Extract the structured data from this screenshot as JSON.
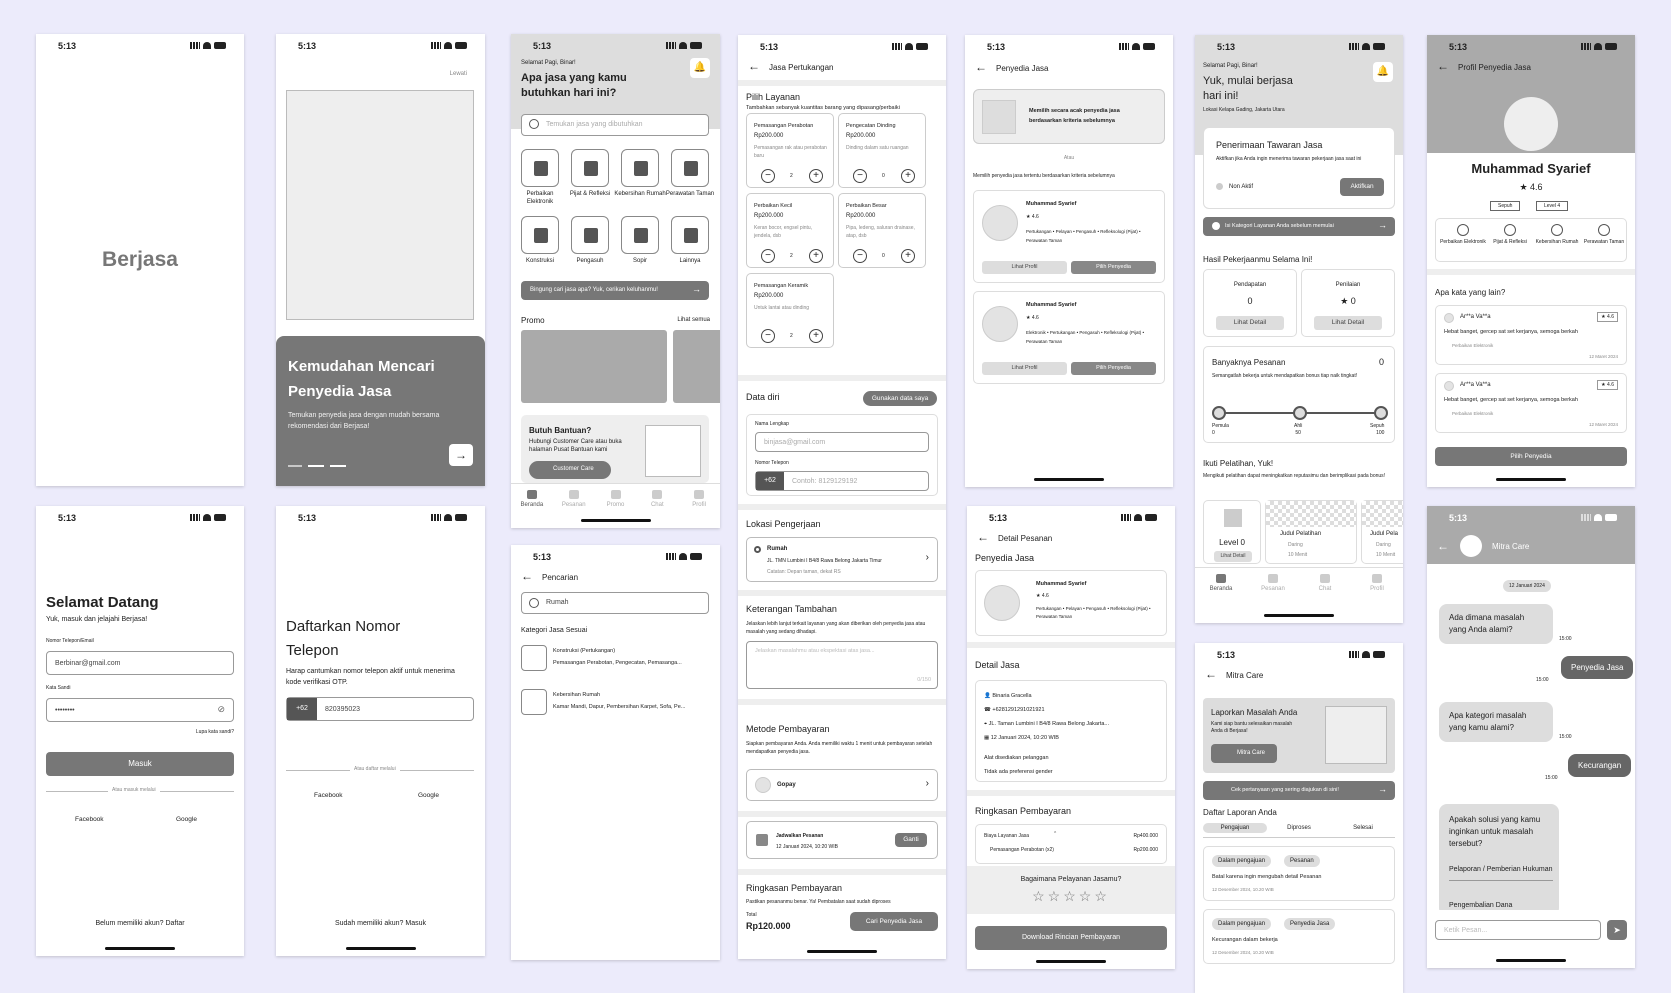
{
  "status_time": "5:13",
  "splash": {
    "title": "Berjasa"
  },
  "onboard": {
    "skip": "Lewati",
    "title": "Kemudahan Mencari Penyedia Jasa",
    "desc": "Temukan penyedia jasa dengan mudah bersama rekomendasi dari Berjasa!"
  },
  "home": {
    "greet": "Selamat Pagi, Binar!",
    "title": "Apa jasa yang kamu butuhkan hari ini?",
    "search_ph": "Temukan jasa yang dibutuhkan",
    "cats": [
      "Perbaikan Elektronik",
      "Pijat & Refleksi",
      "Kebersihan Rumah",
      "Perawatan Taman",
      "Konstruksi",
      "Pengasuh",
      "Sopir",
      "Lainnya"
    ],
    "banner": "Bingung cari jasa apa? Yuk, cerikan keluhanmu!",
    "promo": "Promo",
    "see_all": "Lihat semua",
    "help_title": "Butuh Bantuan?",
    "help_desc": "Hubungi Customer Care atau buka halaman Pusat Bantuan kami",
    "help_btn": "Customer Care"
  },
  "tabs_user": [
    "Beranda",
    "Pesanan",
    "Promo",
    "Chat",
    "Profil"
  ],
  "tabs_mitra": [
    "Beranda",
    "Pesanan",
    "Chat",
    "Profil"
  ],
  "order": {
    "header": "Jasa Pertukangan",
    "choose": "Pilih Layanan",
    "choose_sub": "Tambahkan sebanyak kuantitas barang yang dipasang/perbaiki",
    "items": [
      {
        "name": "Pemasangan Perabotan",
        "price": "Rp200.000",
        "desc": "Pemasangan rak atau perabotan baru",
        "qty": "2"
      },
      {
        "name": "Pengecatan Dinding",
        "price": "Rp200.000",
        "desc": "Dinding dalam satu ruangan",
        "qty": "0"
      },
      {
        "name": "Perbaikan Kecil",
        "price": "Rp200.000",
        "desc": "Keran bocor, engsel pintu, jendela, dsb",
        "qty": "2"
      },
      {
        "name": "Perbaikan Besar",
        "price": "Rp200.000",
        "desc": "Pipa, ledeng, saluran drainase, atap, dsb",
        "qty": "0"
      },
      {
        "name": "Pemasangan Keramik",
        "price": "Rp200.000",
        "desc": "Untuk lantai atau dinding",
        "qty": "2"
      }
    ],
    "data_diri": "Data diri",
    "use_data": "Gunakan data saya",
    "name_label": "Nama Lengkap",
    "name_ph": "binjasa@gmail.com",
    "phone_label": "Nomor Telepon",
    "phone_code": "+62",
    "phone_ph": "Contoh: 8129129192",
    "loc_title": "Lokasi Pengerjaan",
    "loc_name": "Rumah",
    "loc_addr": "JL. TMN Lumbini I B4/8 Rawa Belong Jakarta Timur",
    "loc_note": "Catatan: Depan taman, dekat RS",
    "note_title": "Keterangan Tambahan",
    "note_sub": "Jelaskan lebih lanjut terkait layanan yang akan diberikan oleh penyedia jasa atau masalah yang sedang dihadapi.",
    "note_ph": "Jelaskan masalahmu atau ekspektasi atas jasa...",
    "note_count": "0/150",
    "pay_title": "Metode Pembayaran",
    "pay_sub": "Siapkan pembayaran Anda. Anda memiliki waktu 1 menit untuk pembayaran setelah mendapatkan penyedia jasa.",
    "pay_method": "Gopay",
    "sched_label": "Jadwalkan Pesanan",
    "sched_val": "12 Januari 2024, 10:20 WIB",
    "sched_btn": "Ganti",
    "sum_title": "Ringkasan Pembayaran",
    "sum_sub": "Pastikan pesananmu benar. Ya! Pembatalan saat sudah diproses",
    "total_label": "Total",
    "total": "Rp120.000",
    "cta": "Cari Penyedia Jasa"
  },
  "provider": {
    "header": "Penyedia Jasa",
    "random": "Memilih secara acak penyedia jasa berdasarkan kriteria sebelumnya",
    "or": "Atau",
    "pick_sub": "Memilih penyedia jasa tertentu berdasarkan kriteria sebelumnya",
    "name": "Muhammad Syarief",
    "rating": "4.6",
    "tags1": "Pertukangan • Pelayan • Pengasuh • Refleksologi (Pijat) • Perawatan Taman",
    "tags2": "Elektronik • Pertukangan • Pengasuh • Refleksologi (Pijat) • Perawatan Taman",
    "see": "Lihat Profil",
    "pick": "Pilih Penyedia"
  },
  "detail": {
    "header": "Detail Pesanan",
    "prov": "Penyedia Jasa",
    "det": "Detail Jasa",
    "cust": "Binaria Gracella",
    "phone": "+6281291291021921",
    "addr": "JL. Taman Lumbini I B4/8 Rawa Belong Jakarta...",
    "date": "12 Januari 2024, 10:20 WIB",
    "tool": "Alat disediakan pelanggan",
    "gender": "Tidak ada preferensi gender",
    "sum": "Ringkasan Pembayaran",
    "fee": "Biaya Layanan Jasa",
    "fee_val": "Rp400.000",
    "line": "Pemasangan Perabotan (x2)",
    "line_val": "Rp200.000",
    "ask": "Bagaimana Pelayanan Jasamu?",
    "dl": "Download Rincian Pembayaran"
  },
  "mitra": {
    "greet": "Selamat Pagi, Binar!",
    "title": "Yuk, mulai berjasa hari ini!",
    "loc_label": "Lokasi",
    "loc": "Kelapa Gading, Jakarta Utara",
    "offer": "Penerimaan Tawaran Jasa",
    "offer_sub": "Aktifkan jika Anda ingin menerima tawaran pekerjaan jasa saat ini",
    "inactive": "Non Aktif",
    "activate": "Aktifkan",
    "banner": "Isi Kategori Layanan Anda sebelum memulai",
    "result": "Hasil Pekerjaanmu Selama Ini!",
    "income": "Pendapatan",
    "income_v": "0",
    "rating": "Penilaian",
    "rating_v": "0",
    "detail": "Lihat Detail",
    "orders": "Banyaknya Pesanan",
    "orders_v": "0",
    "orders_sub": "Semangatlah bekerja untuk mendapatkan bonus tiap naik tingkat!",
    "lv1": "Pemula",
    "lv1v": "0",
    "lv2": "Ahli",
    "lv2v": "50",
    "lv3": "Sepuh",
    "lv3v": "100",
    "train": "Ikuti Pelatihan, Yuk!",
    "train_sub": "Mengikuti pelatihan dapat meningkatkan reputasimu dan berimplikasi pada bonus!",
    "level": "Level 0",
    "see": "Lihat Detail",
    "course": "Judul Pelatihan",
    "course2": "Judul Pela",
    "mode": "Daring",
    "dur": "10 Menit"
  },
  "profile": {
    "header": "Profil Penyedia Jasa",
    "name": "Muhammad Syarief",
    "rating": "4.6",
    "badge1": "Sepuh",
    "badge2": "Level 4",
    "skills": [
      "Perbaikan Elektronik",
      "Pijat & Refleksi",
      "Kebersihan Rumah",
      "Perawatan Taman"
    ],
    "others": "Apa kata yang lain?",
    "reviews": [
      {
        "user": "Ar**a Va**a",
        "rate": "4.6",
        "text": "Hebat banget, gercep sat set kerjanya, semoga berkah",
        "cat": "Perbaikan Elektronik",
        "date": "12 Maret 2024"
      },
      {
        "user": "Ar**a Va**a",
        "rate": "4.6",
        "text": "Hebat banget, gercep sat set kerjanya, semoga berkah",
        "cat": "Perbaikan Elektronik",
        "date": "12 Maret 2024"
      }
    ],
    "cta": "Pilih Penyedia"
  },
  "login": {
    "title": "Selamat Datang",
    "sub": "Yuk, masuk dan jelajahi Berjasa!",
    "email_label": "Nomor Telepon/Email",
    "email": "Berbinar@gmail.com",
    "pass_label": "Kata Sandi",
    "pass": "••••••••",
    "forgot": "Lupa kata sandi?",
    "btn": "Masuk",
    "or": "Atau masuk melalui",
    "fb": "Facebook",
    "google": "Google",
    "footer": "Belum memiliki akun? Daftar"
  },
  "register": {
    "title": "Daftarkan Nomor Telepon",
    "sub": "Harap cantumkan nomor telepon aktif untuk menerima kode verifikasi OTP.",
    "code": "+62",
    "phone": "820395023",
    "or": "Atau daftar melalui",
    "fb": "Facebook",
    "google": "Google",
    "footer": "Sudah memiliki akun? Masuk"
  },
  "search": {
    "header": "Pencarian",
    "query": "Rumah",
    "cat_title": "Kategori Jasa Sesuai",
    "results": [
      {
        "name": "Konstruksi (Pertukangan)",
        "desc": "Pemasangan Perabotan, Pengecatan, Pemasanga..."
      },
      {
        "name": "Kebersihan Rumah",
        "desc": "Kamar Mandi, Dapur, Pembersihan Karpet, Sofa, Pe..."
      }
    ]
  },
  "care": {
    "header": "Mitra Care",
    "report": "Laporkan Masalah Anda",
    "report_sub": "Kami siap bantu selesaikan masalah Anda di Berjasa!",
    "btn": "Mitra Care",
    "faq": "Cek pertanyaan yang sering diajukan di sini!",
    "list": "Daftar Laporan Anda",
    "tabs": [
      "Pengajuan",
      "Diproses",
      "Selesai"
    ],
    "reports": [
      {
        "s": "Dalam pengajuan",
        "t": "Pesanan",
        "title": "Batal karena ingin mengubah detail Pesanan",
        "date": "12 Desember 2024, 10.20 WIB"
      },
      {
        "s": "Dalam pengajuan",
        "t": "Penyedia Jasa",
        "title": "Kecurangan dalam bekerja",
        "date": "12 Desember 2024, 10.20 WIB"
      }
    ]
  },
  "chat": {
    "header": "Mitra Care",
    "date": "12 Januari 2024",
    "m1": "Ada dimana masalah yang Anda alami?",
    "t1": "15:00",
    "r1": "Penyedia Jasa",
    "t2": "15:00",
    "m2": "Apa kategori masalah yang kamu alami?",
    "t3": "15:00",
    "r2": "Kecurangan",
    "t4": "15:00",
    "m3": "Apakah solusi yang kamu inginkan untuk masalah tersebut?",
    "o1": "Pelaporan / Pemberian Hukuman",
    "o2": "Pengembalian Dana",
    "ph": "Ketik Pesan..."
  }
}
